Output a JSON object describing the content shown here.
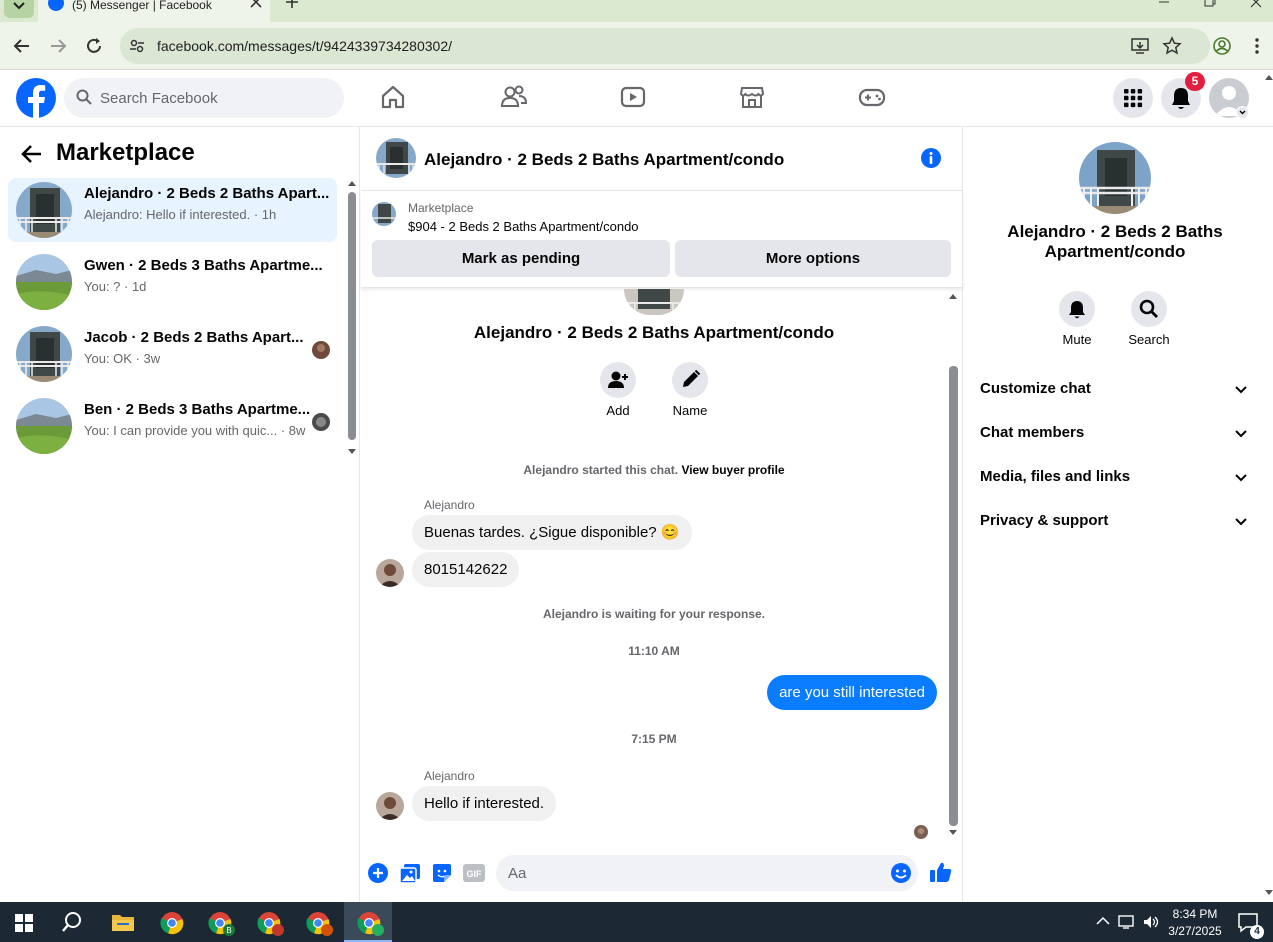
{
  "browser": {
    "tab_title": "(5) Messenger | Facebook",
    "url": "facebook.com/messages/t/9424339734280302/"
  },
  "header": {
    "search_placeholder": "Search Facebook",
    "notification_count": "5",
    "brand_color": "#0866ff"
  },
  "sidebar": {
    "title": "Marketplace",
    "conversations": [
      {
        "name": "Alejandro · 2 Beds 2 Baths Apart...",
        "preview": "Alejandro: Hello if interested. · 1h",
        "active": true
      },
      {
        "name": "Gwen · 2 Beds 3 Baths Apartme...",
        "preview": "You: ? · 1d"
      },
      {
        "name": "Jacob · 2 Beds 2 Baths Apart...",
        "preview": "You: OK · 3w"
      },
      {
        "name": "Ben · 2 Beds 3 Baths Apartme...",
        "preview": "You: I can provide you with quic... · 8w"
      }
    ]
  },
  "chat": {
    "title": "Alejandro · 2 Beds 2 Baths Apartment/condo",
    "listing_source": "Marketplace",
    "listing_price": "$904 - 2 Beds 2 Baths Apartment/condo",
    "mark_pending_label": "Mark as pending",
    "more_options_label": "More options",
    "intro_title": "Alejandro · 2 Beds 2 Baths Apartment/condo",
    "add_label": "Add",
    "name_label": "Name",
    "started_text": "Alejandro started this chat.",
    "view_profile_link": "View buyer profile",
    "sender_name": "Alejandro",
    "msg1": "Buenas tardes. ¿Sigue disponible? 😊",
    "msg2": "8015142622",
    "waiting_text": "Alejandro is waiting for your response.",
    "time1": "11:10 AM",
    "my_msg": "are you still interested",
    "time2": "7:15 PM",
    "msg3": "Hello if interested.",
    "composer_placeholder": "Aa",
    "outgoing_color": "#0a7cff"
  },
  "details": {
    "name": "Alejandro · 2 Beds 2 Baths Apartment/condo",
    "mute_label": "Mute",
    "search_label": "Search",
    "sections": [
      "Customize chat",
      "Chat members",
      "Media, files and links",
      "Privacy & support"
    ]
  },
  "taskbar": {
    "time": "8:34 PM",
    "date": "3/27/2025",
    "notif_count": "4"
  }
}
